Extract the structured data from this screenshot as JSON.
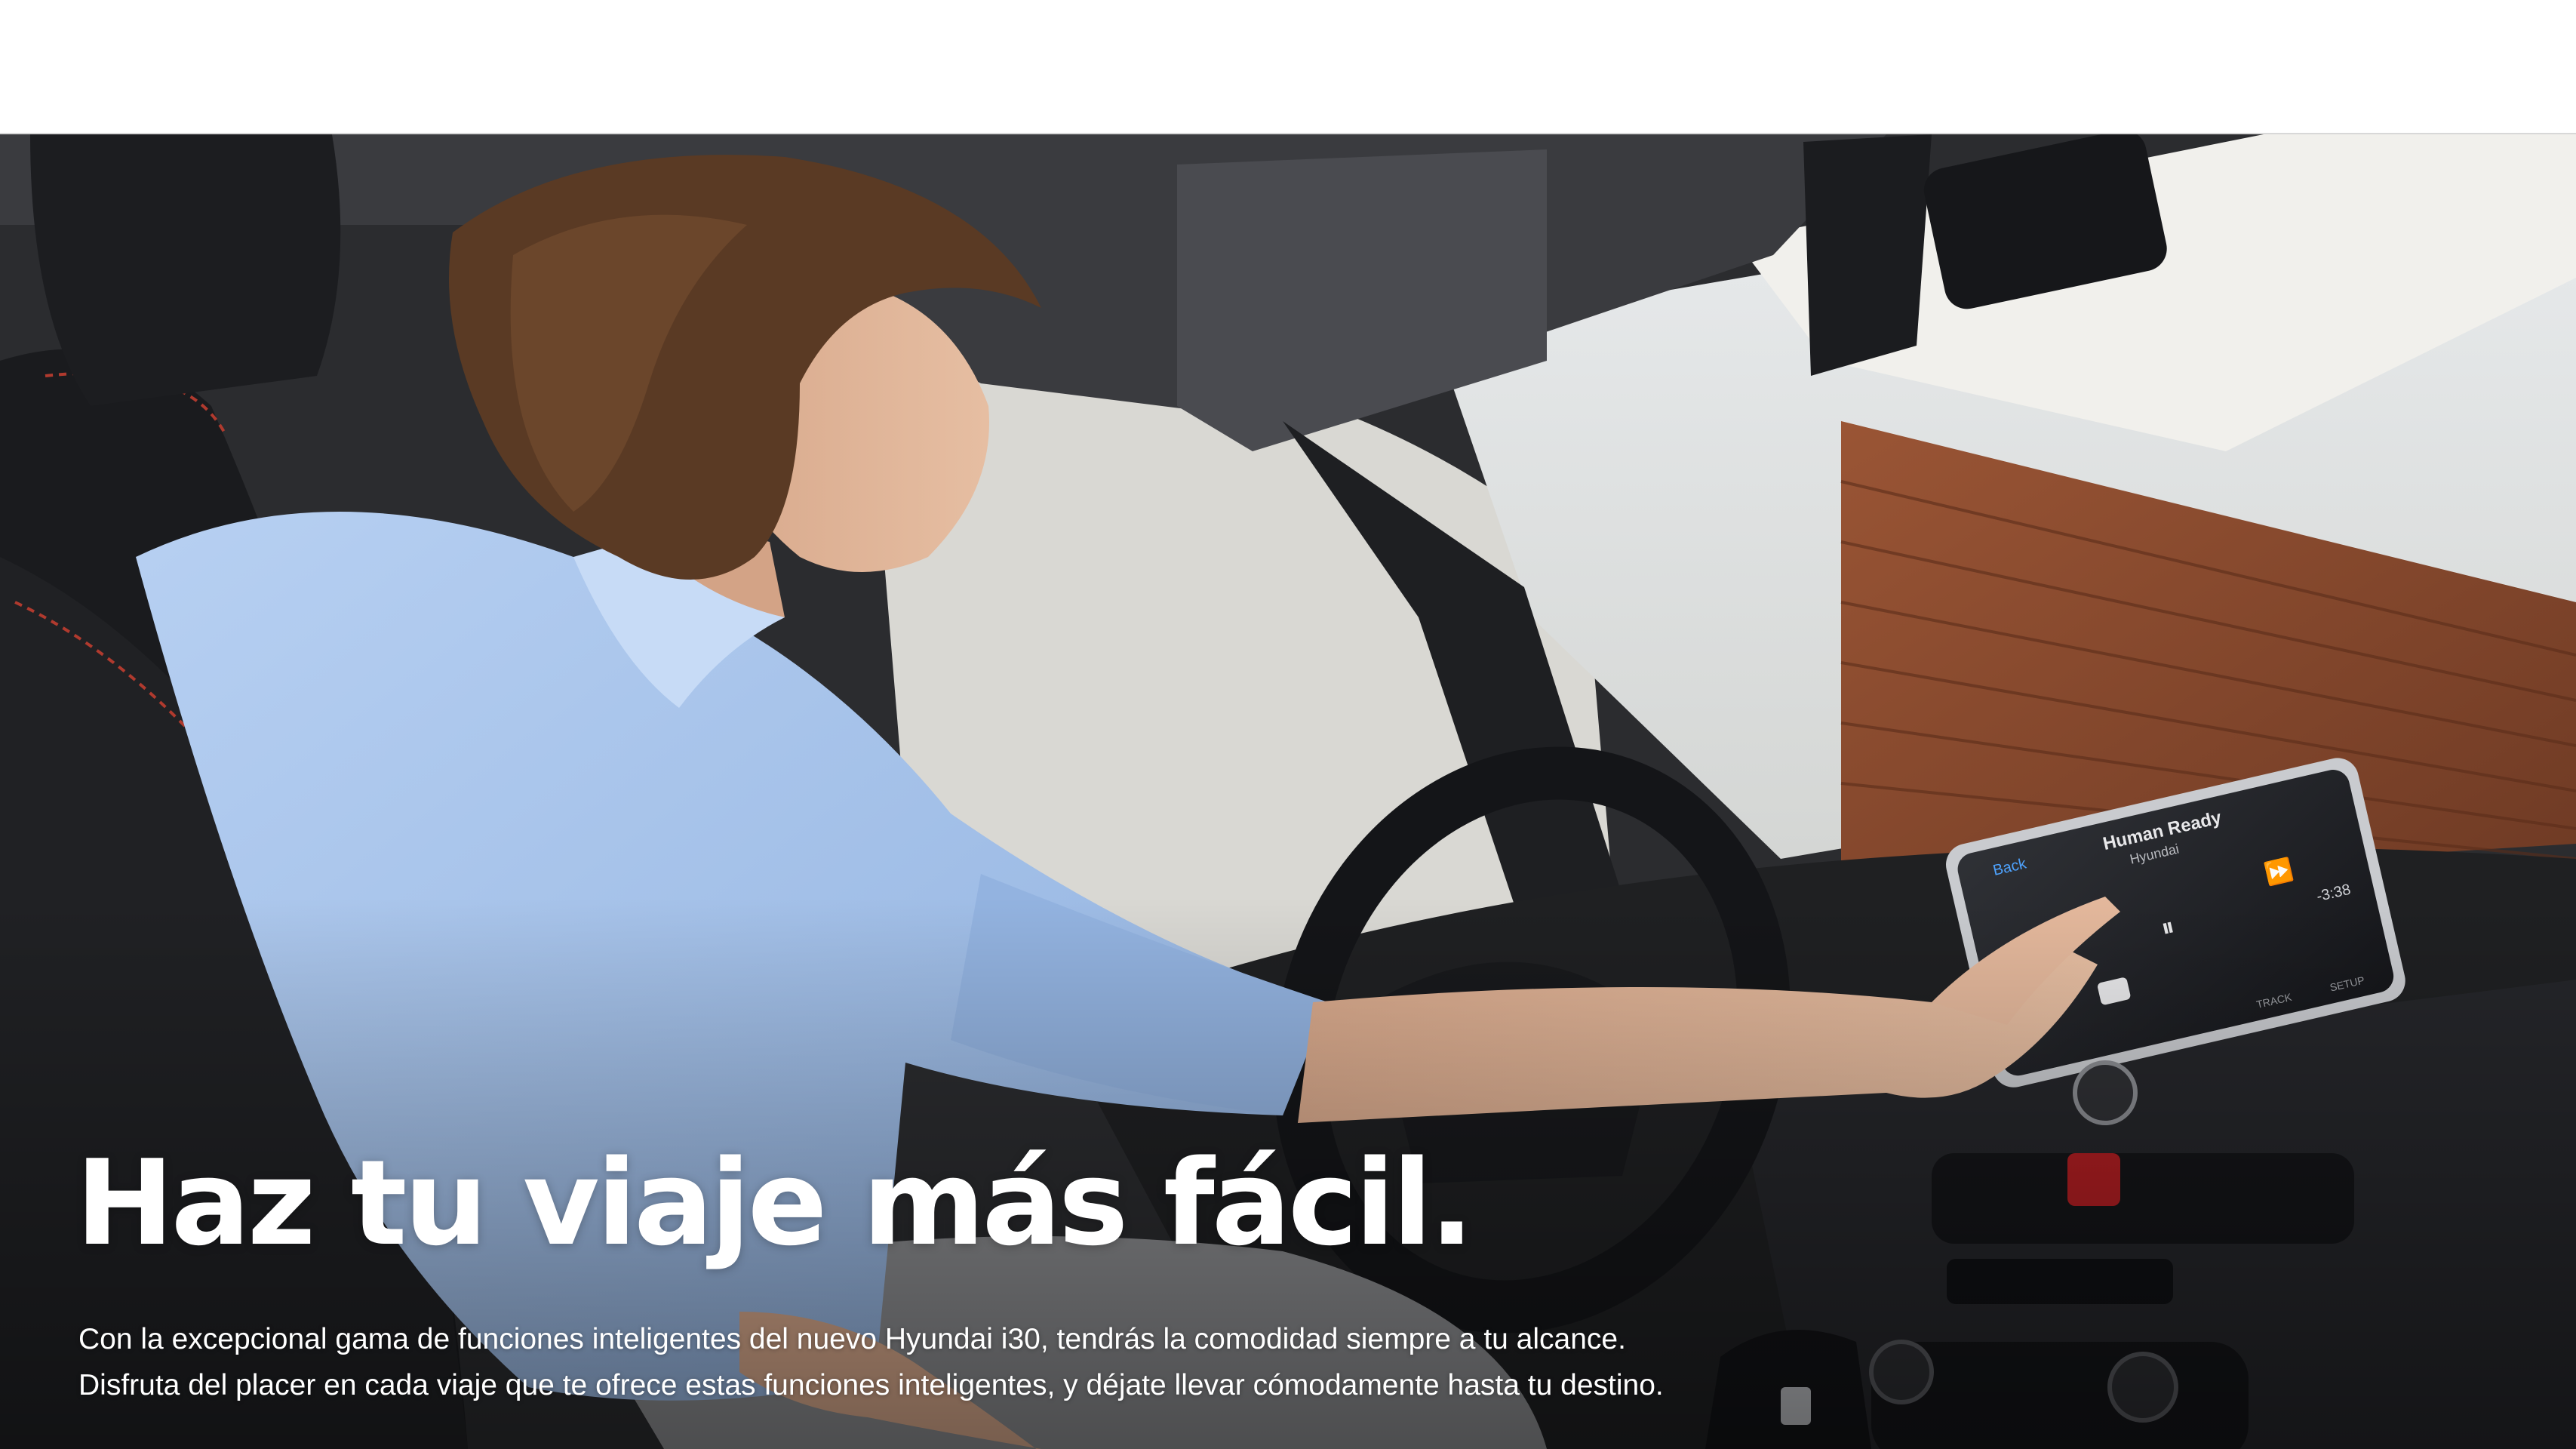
{
  "hero": {
    "headline": "Haz tu viaje más fácil.",
    "description_lines": [
      "Con la excepcional gama de funciones inteligentes del nuevo Hyundai i30, tendrás la comodidad siempre a tu alcance.",
      "Disfruta del placer en cada viaje que te ofrece estas funciones inteligentes, y déjate llevar cómodamente hasta tu destino."
    ]
  },
  "infotainment": {
    "back_label": "Back",
    "track_title": "Human Ready",
    "artist": "Hyundai",
    "time_remaining": "-3:38",
    "soft_keys": [
      "TRACK",
      "SETUP"
    ]
  },
  "colors": {
    "shirt": "#a9c6ec",
    "hair": "#5a3a24",
    "wood_panel": "#8a4a2e",
    "dashboard": "#1f2022"
  }
}
